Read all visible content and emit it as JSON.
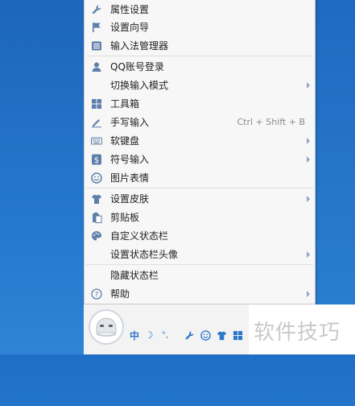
{
  "menu": {
    "items": [
      {
        "label": "属性设置",
        "icon": "wrench-icon"
      },
      {
        "label": "设置向导",
        "icon": "flag-icon"
      },
      {
        "label": "输入法管理器",
        "icon": "manager-list-icon"
      },
      {
        "label": "QQ账号登录",
        "icon": "user-icon"
      },
      {
        "label": "切换输入模式",
        "icon": "",
        "submenu": true
      },
      {
        "label": "工具箱",
        "icon": "toolbox-grid-icon"
      },
      {
        "label": "手写输入",
        "icon": "pencil-icon",
        "shortcut": "Ctrl + Shift + B"
      },
      {
        "label": "软键盘",
        "icon": "keyboard-icon",
        "submenu": true
      },
      {
        "label": "符号输入",
        "icon": "dollar-symbol-icon",
        "submenu": true
      },
      {
        "label": "图片表情",
        "icon": "smiley-icon"
      },
      {
        "label": "设置皮肤",
        "icon": "shirt-icon",
        "submenu": true
      },
      {
        "label": "剪贴板",
        "icon": "clipboard-icon"
      },
      {
        "label": "自定义状态栏",
        "icon": "palette-icon"
      },
      {
        "label": "设置状态栏头像",
        "icon": "",
        "submenu": true
      },
      {
        "label": "隐藏状态栏",
        "icon": ""
      },
      {
        "label": "帮助",
        "icon": "help-icon",
        "submenu": true
      }
    ]
  },
  "statusbar": {
    "mode_label": "中",
    "moon_glyph": "☽",
    "punct_glyph": "°,",
    "buttons": [
      "wrench-icon",
      "smiley-icon",
      "shirt-icon",
      "toolbox-grid-icon"
    ]
  },
  "watermark": "软件技巧",
  "colors": {
    "icon": "#5e7fa8",
    "accent": "#2f78c9",
    "desktop": "#2a7fd4"
  }
}
